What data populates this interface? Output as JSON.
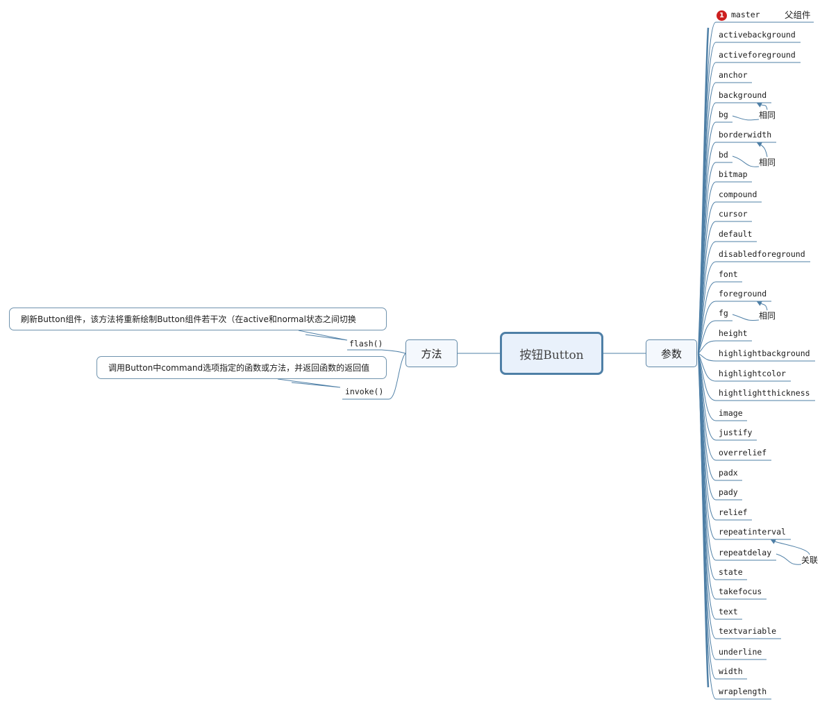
{
  "root": {
    "label": "按钮Button"
  },
  "right_branch": {
    "label": "参数",
    "items": [
      {
        "label": "master"
      },
      {
        "label": "activebackground"
      },
      {
        "label": "activeforeground"
      },
      {
        "label": "anchor"
      },
      {
        "label": "background"
      },
      {
        "label": "bg"
      },
      {
        "label": "borderwidth"
      },
      {
        "label": "bd"
      },
      {
        "label": "bitmap"
      },
      {
        "label": "compound"
      },
      {
        "label": "cursor"
      },
      {
        "label": "default"
      },
      {
        "label": "disabledforeground"
      },
      {
        "label": "font"
      },
      {
        "label": "foreground"
      },
      {
        "label": "fg"
      },
      {
        "label": "height"
      },
      {
        "label": "highlightbackground"
      },
      {
        "label": "highlightcolor"
      },
      {
        "label": "hightlightthickness"
      },
      {
        "label": "image"
      },
      {
        "label": "justify"
      },
      {
        "label": "overrelief"
      },
      {
        "label": "padx"
      },
      {
        "label": "pady"
      },
      {
        "label": "relief"
      },
      {
        "label": "repeatinterval"
      },
      {
        "label": "repeatdelay"
      },
      {
        "label": "state"
      },
      {
        "label": "takefocus"
      },
      {
        "label": "text"
      },
      {
        "label": "textvariable"
      },
      {
        "label": "underline"
      },
      {
        "label": "width"
      },
      {
        "label": "wraplength"
      }
    ],
    "master_marker": "1",
    "master_note": "父组件",
    "relations": [
      {
        "from": "bg",
        "to": "background",
        "label": "相同"
      },
      {
        "from": "bd",
        "to": "borderwidth",
        "label": "相同"
      },
      {
        "from": "fg",
        "to": "foreground",
        "label": "相同"
      },
      {
        "from": "repeatdelay",
        "to": "repeatinterval",
        "label": "关联"
      }
    ]
  },
  "left_branch": {
    "label": "方法",
    "items": [
      {
        "label": "flash()",
        "note": "刷新Button组件，该方法将重新绘制Button组件若干次（在active和normal状态之间切换"
      },
      {
        "label": "invoke()",
        "note": "调用Button中command选项指定的函数或方法，并返回函数的返回值"
      }
    ]
  },
  "colors": {
    "line": "#4e7fa6",
    "root_fill": "#e9f1fb",
    "marker": "#cc1f1f"
  }
}
